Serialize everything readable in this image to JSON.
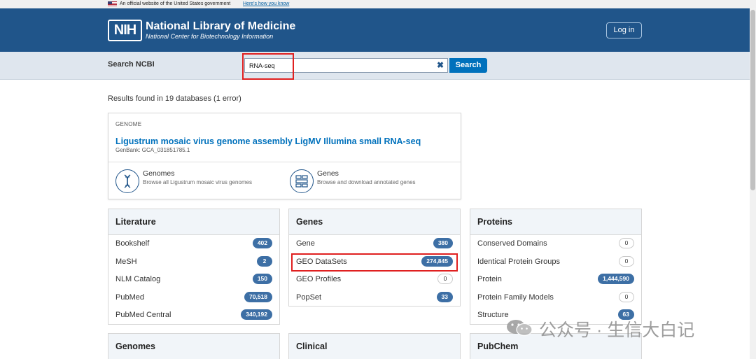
{
  "gov_banner": {
    "text": "An official website of the United States government",
    "link": "Here's how you know"
  },
  "header": {
    "logo": "NIH",
    "title": "National Library of Medicine",
    "subtitle": "National Center for Biotechnology Information",
    "login_label": "Log in"
  },
  "search": {
    "label": "Search NCBI",
    "value": "RNA-seq",
    "clear_glyph": "✖",
    "button_label": "Search"
  },
  "results": {
    "summary": "Results found in 19 databases (1 error)"
  },
  "genome_card": {
    "kind": "GENOME",
    "title": "Ligustrum mosaic virus genome assembly LigMV Illumina small RNA-seq",
    "accession": "GenBank: GCA_031851785.1",
    "features": [
      {
        "title": "Genomes",
        "desc": "Browse all Ligustrum mosaic virus genomes",
        "icon": "dna-icon"
      },
      {
        "title": "Genes",
        "desc": "Browse and download annotated genes",
        "icon": "gene-map-icon"
      }
    ]
  },
  "panels": {
    "literature": {
      "title": "Literature",
      "rows": [
        {
          "label": "Bookshelf",
          "count": "402"
        },
        {
          "label": "MeSH",
          "count": "2"
        },
        {
          "label": "NLM Catalog",
          "count": "150"
        },
        {
          "label": "PubMed",
          "count": "70,518"
        },
        {
          "label": "PubMed Central",
          "count": "340,192"
        }
      ]
    },
    "genes": {
      "title": "Genes",
      "rows": [
        {
          "label": "Gene",
          "count": "380"
        },
        {
          "label": "GEO DataSets",
          "count": "274,845"
        },
        {
          "label": "GEO Profiles",
          "count": "0"
        },
        {
          "label": "PopSet",
          "count": "33"
        }
      ]
    },
    "proteins": {
      "title": "Proteins",
      "rows": [
        {
          "label": "Conserved Domains",
          "count": "0"
        },
        {
          "label": "Identical Protein Groups",
          "count": "0"
        },
        {
          "label": "Protein",
          "count": "1,444,590"
        },
        {
          "label": "Protein Family Models",
          "count": "0"
        },
        {
          "label": "Structure",
          "count": "63"
        }
      ]
    },
    "genomes": {
      "title": "Genomes"
    },
    "clinical": {
      "title": "Clinical"
    },
    "pubchem": {
      "title": "PubChem"
    }
  },
  "watermark": {
    "text": "公众号 · 生信大白记"
  },
  "colors": {
    "header_bg": "#20558a",
    "link": "#0071bc",
    "badge": "#3d6fa5",
    "highlight": "#e02020"
  }
}
